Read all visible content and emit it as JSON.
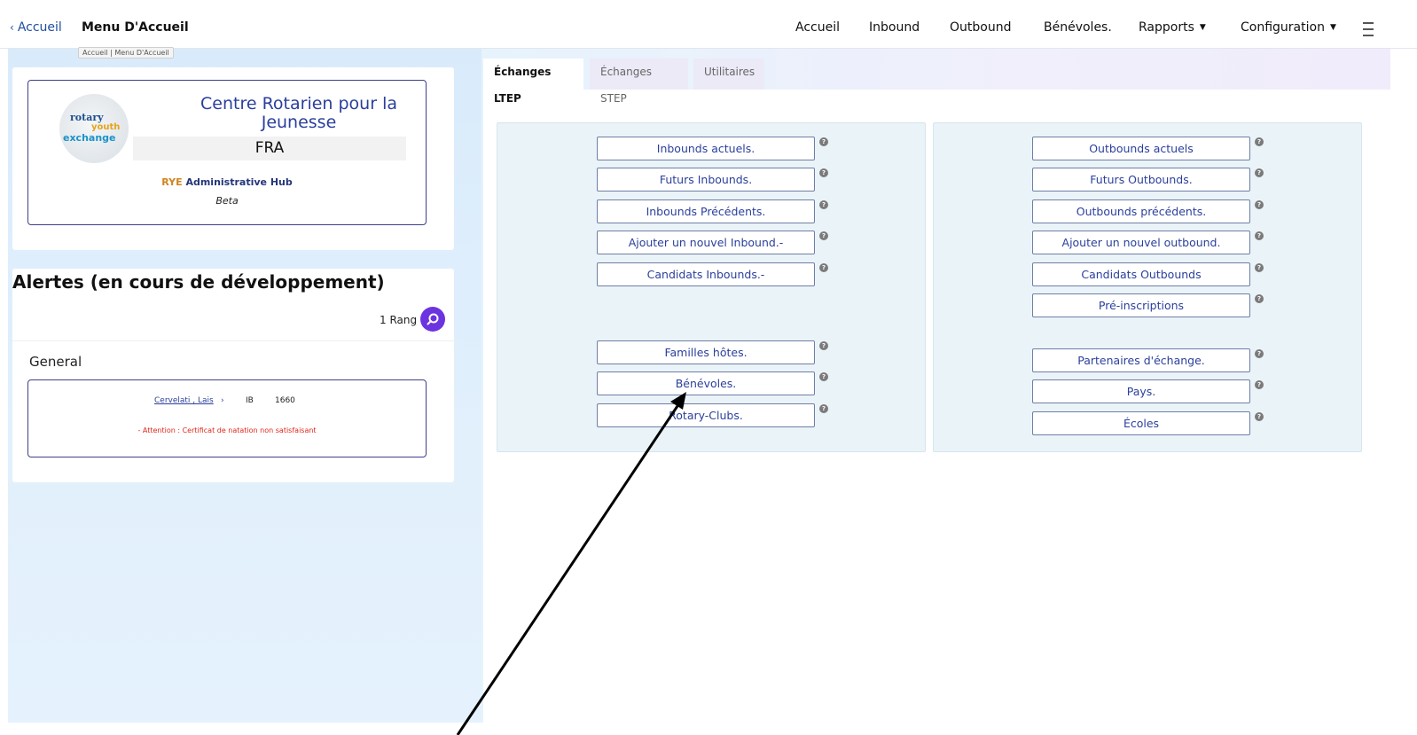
{
  "topbar": {
    "back_label": "Accueil",
    "menu_title": "Menu D'Accueil",
    "breadcrumb_tooltip": "Accueil | Menu D'Accueil",
    "nav": [
      "Accueil",
      "Inbound",
      "Outbound",
      "Bénévoles.",
      "Rapports",
      "Configuration"
    ]
  },
  "org": {
    "logo_lines": [
      "rotary",
      "youth",
      "exchange"
    ],
    "name": "Centre Rotarien pour la Jeunesse",
    "country": "FRA",
    "hub_prefix": "RYE",
    "hub_label": "Administrative Hub",
    "beta": "Beta"
  },
  "alerts": {
    "title": "Alertes (en cours de développement)",
    "rows_label": "1 Rang",
    "section": "General",
    "student": "Cervelati , Lais",
    "arrow": "›",
    "type": "IB",
    "id": "1660",
    "warning": "- Attention : Certificat de natation non satisfaisant"
  },
  "tabs": [
    "Échanges LTEP",
    "Échanges STEP",
    "Utilitaires"
  ],
  "inbound_buttons": [
    "Inbounds actuels.",
    "Futurs Inbounds.",
    "Inbounds Précédents.",
    "Ajouter un nouvel Inbound.-",
    "Candidats Inbounds.-",
    "Familles hôtes.",
    "Bénévoles.",
    "Rotary-Clubs."
  ],
  "outbound_buttons": [
    "Outbounds actuels",
    "Futurs Outbounds.",
    "Outbounds précédents.",
    "Ajouter un nouvel outbound.",
    "Candidats Outbounds",
    "Pré-inscriptions",
    "Partenaires d'échange.",
    "Pays.",
    "Écoles"
  ],
  "help_glyph": "?",
  "colors": {
    "accent": "#2a3f9c",
    "search_button": "#6b34e0",
    "warning": "#e0261b",
    "panel": "#eaf4f8"
  }
}
